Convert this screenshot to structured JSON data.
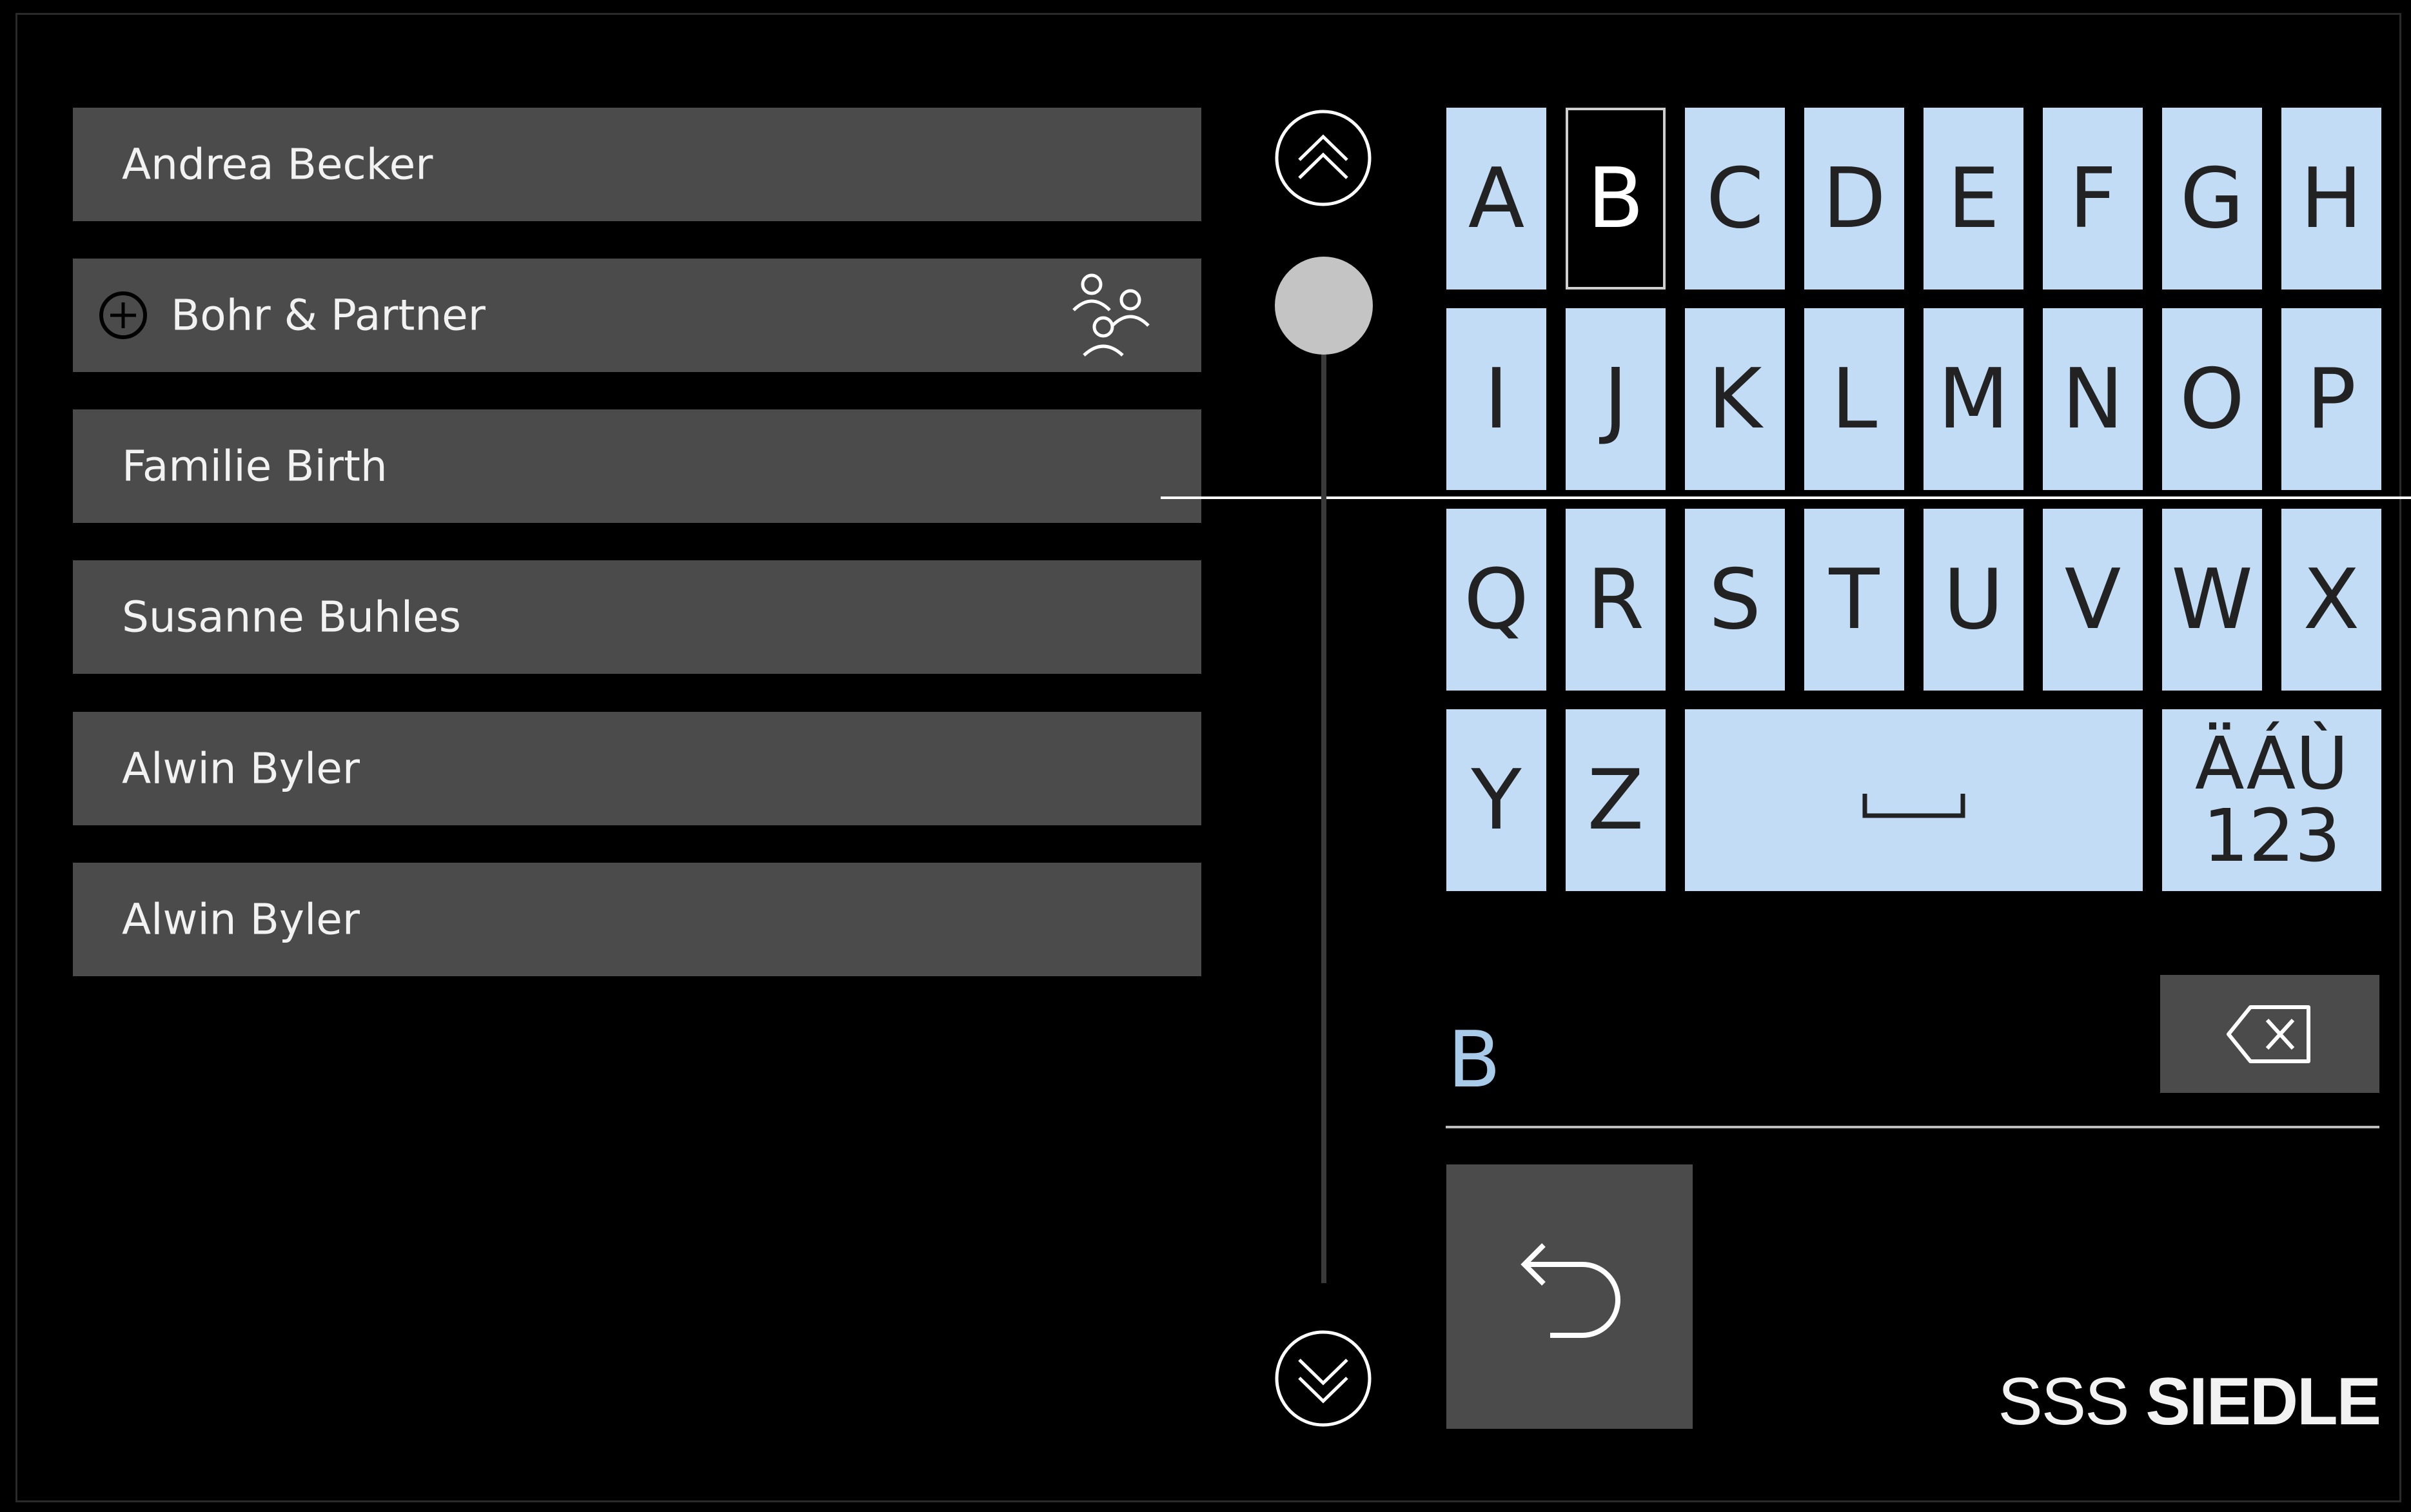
{
  "contacts": [
    {
      "name": "Andrea Becker"
    },
    {
      "name": "Bohr & Partner"
    },
    {
      "name": "Familie Birth"
    },
    {
      "name": "Susanne Buhles"
    },
    {
      "name": "Alwin Byler"
    },
    {
      "name": "Alwin Byler"
    }
  ],
  "keyboard": {
    "rows": [
      [
        "A",
        "B",
        "C",
        "D",
        "E",
        "F",
        "G",
        "H"
      ],
      [
        "I",
        "J",
        "K",
        "L",
        "M",
        "N",
        "O",
        "P"
      ],
      [
        "Q",
        "R",
        "S",
        "T",
        "U",
        "V",
        "W",
        "X"
      ],
      [
        "Y",
        "Z"
      ]
    ],
    "selected_key": "B",
    "special_key_line1": "ÄÁÙ",
    "special_key_line2": "123"
  },
  "input": {
    "value": "B"
  },
  "logo": {
    "mark": "SSS",
    "brand": "SIEDLE"
  },
  "icons": {
    "scroll_up": "double-chevron-up-icon",
    "scroll_down": "double-chevron-down-icon",
    "backspace": "backspace-icon",
    "back": "back-arrow-icon",
    "group": "group-icon",
    "add": "plus-circle-icon"
  },
  "colors": {
    "key_bg": "#c2dcf5",
    "list_bg": "#4b4b4b",
    "input_text": "#a9cbea",
    "background": "#000000"
  }
}
